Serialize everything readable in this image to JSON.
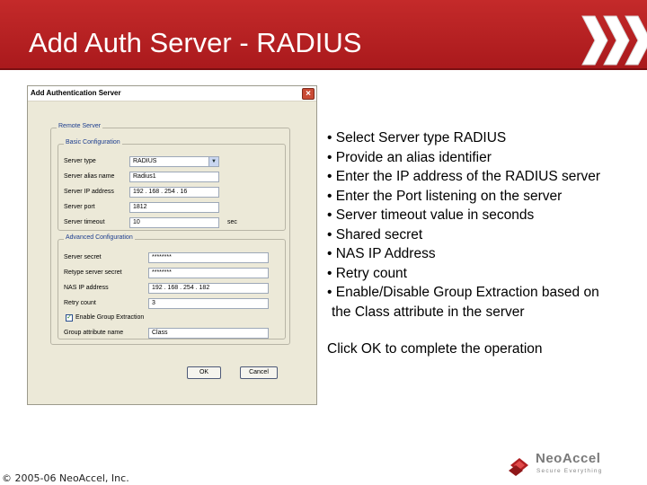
{
  "slide": {
    "title": "Add Auth Server - RADIUS",
    "copyright": "© 2005-06 NeoAccel, Inc."
  },
  "logo": {
    "wordmark": "NeoAccel",
    "tagline": "Secure Everything"
  },
  "dialog": {
    "title": "Add Authentication Server",
    "group_remote": "Remote Server",
    "group_basic": "Basic Configuration",
    "group_advanced": "Advanced Configuration",
    "labels": {
      "server_type": "Server type",
      "alias": "Server alias name",
      "ip": "Server IP address",
      "port": "Server port",
      "timeout": "Server timeout",
      "timeout_unit": "sec",
      "secret": "Server secret",
      "retype_secret": "Retype server secret",
      "nas_ip": "NAS IP address",
      "retry": "Retry count",
      "enable_group": "Enable Group Extraction",
      "group_attr": "Group attribute name"
    },
    "values": {
      "server_type": "RADIUS",
      "alias": "Radius1",
      "ip": "192 . 168 . 254 . 16",
      "port": "1812",
      "timeout": "10",
      "secret": "********",
      "retype_secret": "********",
      "nas_ip": "192 . 168 . 254 . 182",
      "retry": "3",
      "group_attr": "Class"
    },
    "enable_group_checked": "✓",
    "ok_label": "OK",
    "cancel_label": "Cancel"
  },
  "bullets": [
    "• Select Server type RADIUS",
    "• Provide an alias identifier",
    "• Enter the IP address of the RADIUS server",
    "• Enter the Port listening on the server",
    "• Server timeout value in seconds",
    "• Shared secret",
    "• NAS IP Address",
    "• Retry count",
    "• Enable/Disable Group Extraction based on"
  ],
  "bullet_continuation": "the Class attribute in the server",
  "ok_note": "Click OK to complete the operation",
  "colors": {
    "title_band": "#b01f22",
    "text": "#000000",
    "dialog_bg": "#ece9d8"
  }
}
